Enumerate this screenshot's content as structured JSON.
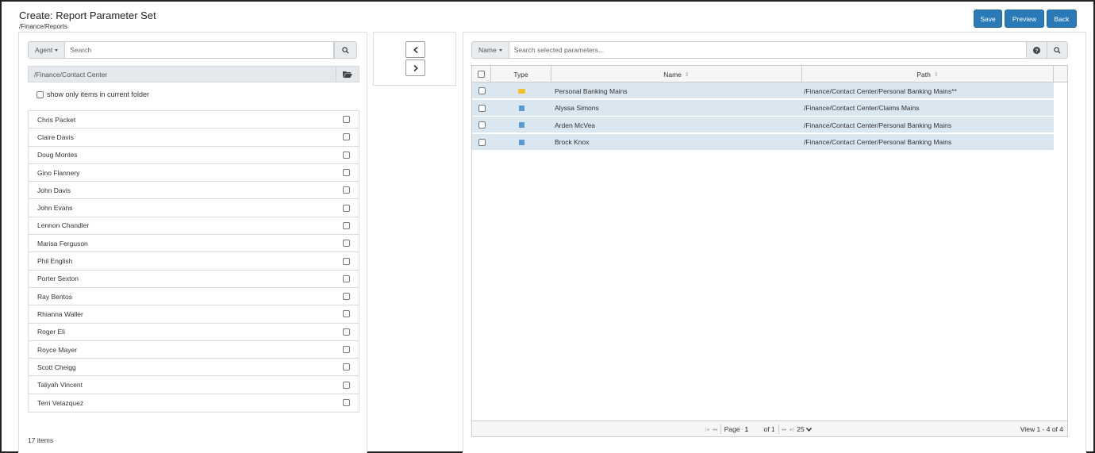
{
  "header": {
    "title": "Create: Report Parameter Set",
    "subpath": "/Finance/Reports",
    "buttons": {
      "save": "Save",
      "preview": "Preview",
      "back": "Back"
    }
  },
  "left_panel": {
    "filter_label": "Agent",
    "search_placeholder": "Search",
    "folder_path": "/Finance/Contact Center",
    "show_only_label": "show only items in current folder",
    "agents": [
      "Chris Packet",
      "Claire Davis",
      "Doug Montes",
      "Gino Flannery",
      "John Davis",
      "John Evans",
      "Lennon Chandler",
      "Marisa Ferguson",
      "Phil English",
      "Porter Sexton",
      "Ray Bentos",
      "Rhianna Waller",
      "Roger Eli",
      "Royce Mayer",
      "Scott Cheigg",
      "Taliyah Vincent",
      "Terri Velazquez"
    ],
    "item_count": "17 items"
  },
  "right_panel": {
    "filter_label": "Name",
    "search_placeholder": "Search selected parameters...",
    "columns": {
      "type": "Type",
      "name": "Name",
      "path": "Path"
    },
    "rows": [
      {
        "type": "folder",
        "name": "Personal Banking Mains",
        "path": "/Finance/Contact Center/Personal Banking Mains**"
      },
      {
        "type": "agent",
        "name": "Alyssa Simons",
        "path": "/Finance/Contact Center/Claims Mains"
      },
      {
        "type": "agent",
        "name": "Arden McVea",
        "path": "/Finance/Contact Center/Personal Banking Mains"
      },
      {
        "type": "agent",
        "name": "Brock Knox",
        "path": "/Finance/Contact Center/Personal Banking Mains"
      }
    ],
    "pager": {
      "page_label": "Page",
      "page_value": "1",
      "of_label": "of 1",
      "page_size": "25",
      "view_label": "View 1 - 4 of 4"
    }
  },
  "colors": {
    "primary_button": "#2a7ab8",
    "selected_row": "#dae6f0",
    "folder_icon": "#f5c02b",
    "agent_icon": "#5b9bd5"
  }
}
